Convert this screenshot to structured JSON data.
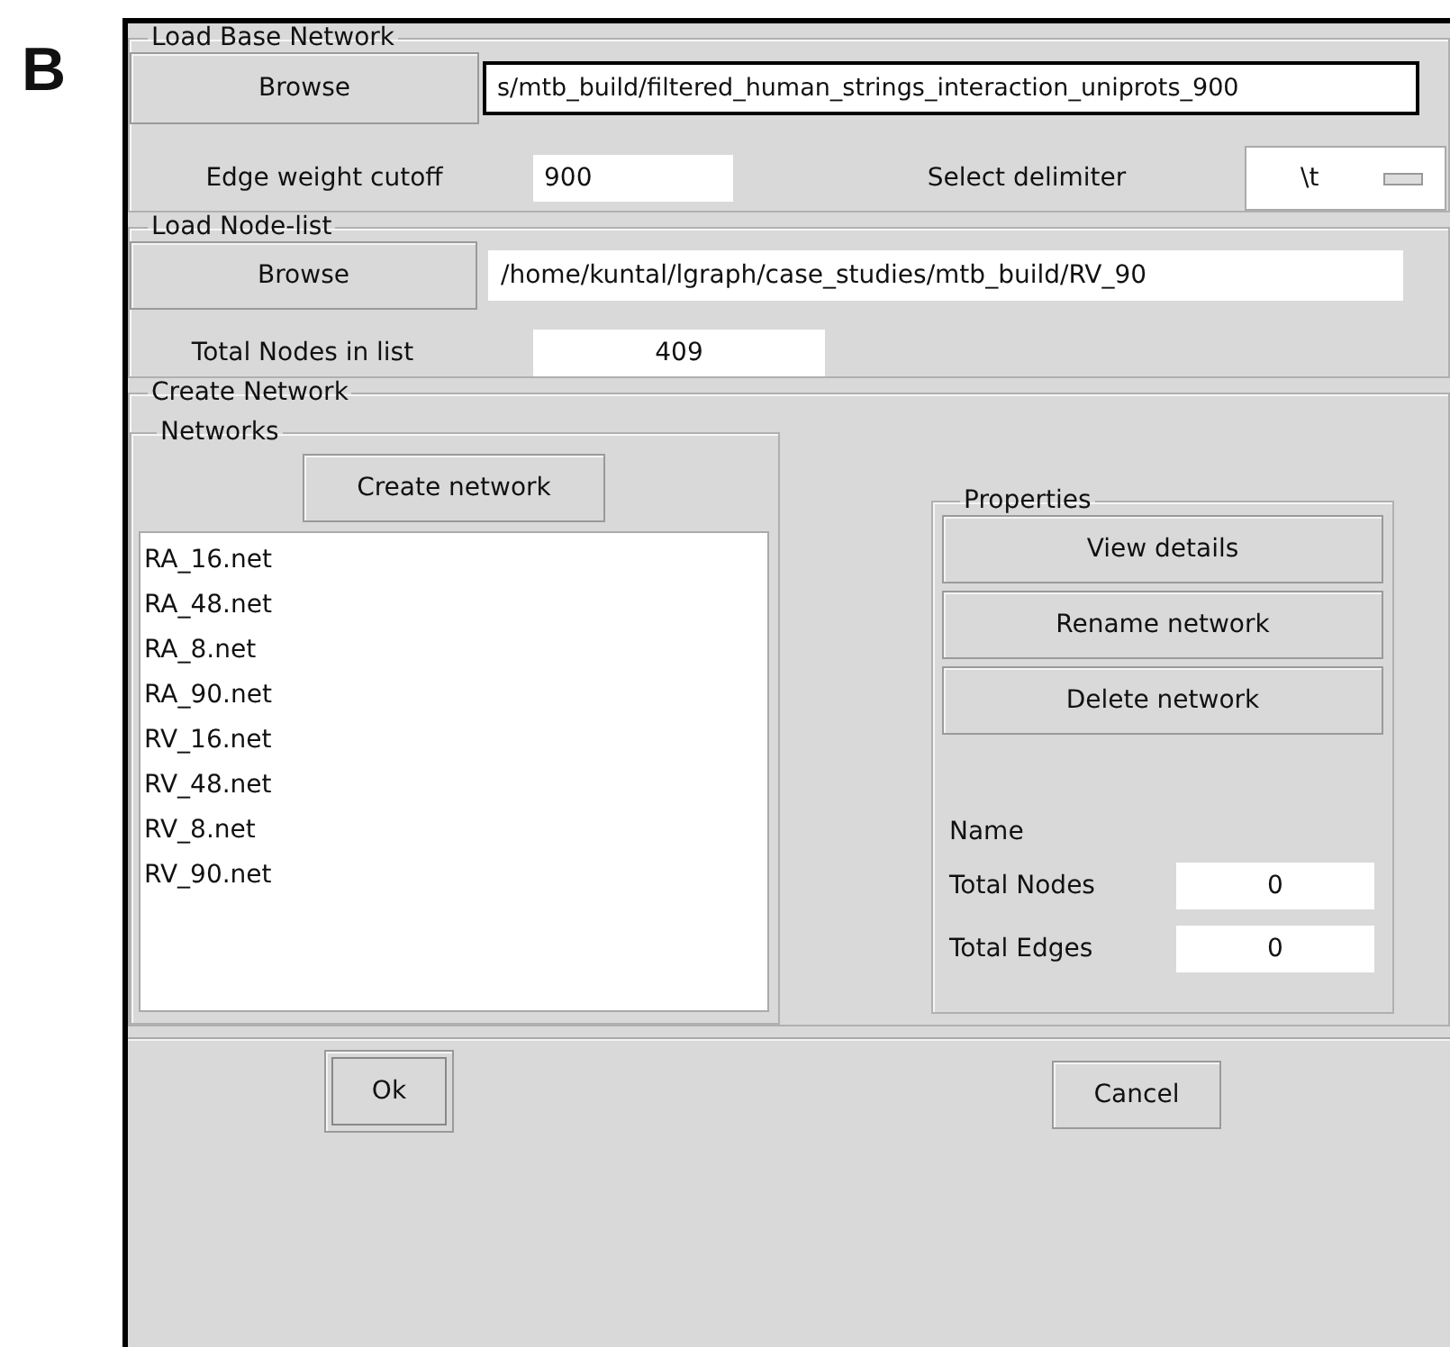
{
  "panel_label": "B",
  "base_network": {
    "title": "Load Base Network",
    "browse_button": "Browse",
    "path": "s/mtb_build/filtered_human_strings_interaction_uniprots_900",
    "path_focused": true,
    "cutoff_label": "Edge weight cutoff",
    "cutoff_value": "900",
    "delimiter_label": "Select delimiter",
    "delimiter_value": "\\t"
  },
  "node_list": {
    "title": "Load Node-list",
    "browse_button": "Browse",
    "path": "/home/kuntal/lgraph/case_studies/mtb_build/RV_90",
    "path_focused": false,
    "total_label": "Total Nodes in list",
    "total_value": "409"
  },
  "create_network": {
    "title": "Create Network",
    "networks": {
      "title": "Networks",
      "create_button": "Create network",
      "items": [
        {
          "label": "RA_16.net",
          "selected": false
        },
        {
          "label": "RA_48.net",
          "selected": false
        },
        {
          "label": "RA_8.net",
          "selected": false
        },
        {
          "label": "RA_90.net",
          "selected": false
        },
        {
          "label": "RV_16.net",
          "selected": false
        },
        {
          "label": "RV_48.net",
          "selected": false
        },
        {
          "label": "RV_8.net",
          "selected": false
        },
        {
          "label": "RV_90.net",
          "selected": false
        }
      ]
    },
    "properties": {
      "title": "Properties",
      "buttons": [
        "View details",
        "Rename network",
        "Delete network"
      ],
      "name_label": "Name",
      "fields": [
        {
          "label": "Total Nodes",
          "value": "0"
        },
        {
          "label": "Total Edges",
          "value": "0"
        }
      ]
    }
  },
  "buttons": [
    {
      "label": "Ok",
      "default": true
    },
    {
      "label": "Cancel",
      "default": false
    }
  ]
}
